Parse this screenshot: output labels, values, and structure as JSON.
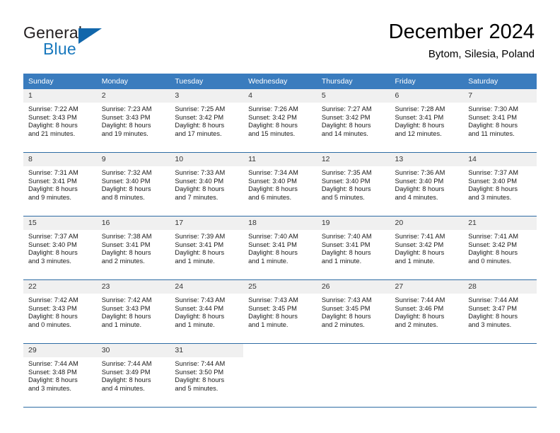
{
  "brand": {
    "name_part1": "General",
    "name_part2": "Blue"
  },
  "header": {
    "title": "December 2024",
    "location": "Bytom, Silesia, Poland"
  },
  "colors": {
    "header_row_bg": "#3a7cbe",
    "day_band_bg": "#f0f0f0",
    "row_divider": "#2e6ca4",
    "brand_blue": "#1878bd"
  },
  "weekdays": [
    "Sunday",
    "Monday",
    "Tuesday",
    "Wednesday",
    "Thursday",
    "Friday",
    "Saturday"
  ],
  "weeks": [
    [
      {
        "day": "1",
        "sunrise": "Sunrise: 7:22 AM",
        "sunset": "Sunset: 3:43 PM",
        "daylight_line1": "Daylight: 8 hours",
        "daylight_line2": "and 21 minutes."
      },
      {
        "day": "2",
        "sunrise": "Sunrise: 7:23 AM",
        "sunset": "Sunset: 3:43 PM",
        "daylight_line1": "Daylight: 8 hours",
        "daylight_line2": "and 19 minutes."
      },
      {
        "day": "3",
        "sunrise": "Sunrise: 7:25 AM",
        "sunset": "Sunset: 3:42 PM",
        "daylight_line1": "Daylight: 8 hours",
        "daylight_line2": "and 17 minutes."
      },
      {
        "day": "4",
        "sunrise": "Sunrise: 7:26 AM",
        "sunset": "Sunset: 3:42 PM",
        "daylight_line1": "Daylight: 8 hours",
        "daylight_line2": "and 15 minutes."
      },
      {
        "day": "5",
        "sunrise": "Sunrise: 7:27 AM",
        "sunset": "Sunset: 3:42 PM",
        "daylight_line1": "Daylight: 8 hours",
        "daylight_line2": "and 14 minutes."
      },
      {
        "day": "6",
        "sunrise": "Sunrise: 7:28 AM",
        "sunset": "Sunset: 3:41 PM",
        "daylight_line1": "Daylight: 8 hours",
        "daylight_line2": "and 12 minutes."
      },
      {
        "day": "7",
        "sunrise": "Sunrise: 7:30 AM",
        "sunset": "Sunset: 3:41 PM",
        "daylight_line1": "Daylight: 8 hours",
        "daylight_line2": "and 11 minutes."
      }
    ],
    [
      {
        "day": "8",
        "sunrise": "Sunrise: 7:31 AM",
        "sunset": "Sunset: 3:41 PM",
        "daylight_line1": "Daylight: 8 hours",
        "daylight_line2": "and 9 minutes."
      },
      {
        "day": "9",
        "sunrise": "Sunrise: 7:32 AM",
        "sunset": "Sunset: 3:40 PM",
        "daylight_line1": "Daylight: 8 hours",
        "daylight_line2": "and 8 minutes."
      },
      {
        "day": "10",
        "sunrise": "Sunrise: 7:33 AM",
        "sunset": "Sunset: 3:40 PM",
        "daylight_line1": "Daylight: 8 hours",
        "daylight_line2": "and 7 minutes."
      },
      {
        "day": "11",
        "sunrise": "Sunrise: 7:34 AM",
        "sunset": "Sunset: 3:40 PM",
        "daylight_line1": "Daylight: 8 hours",
        "daylight_line2": "and 6 minutes."
      },
      {
        "day": "12",
        "sunrise": "Sunrise: 7:35 AM",
        "sunset": "Sunset: 3:40 PM",
        "daylight_line1": "Daylight: 8 hours",
        "daylight_line2": "and 5 minutes."
      },
      {
        "day": "13",
        "sunrise": "Sunrise: 7:36 AM",
        "sunset": "Sunset: 3:40 PM",
        "daylight_line1": "Daylight: 8 hours",
        "daylight_line2": "and 4 minutes."
      },
      {
        "day": "14",
        "sunrise": "Sunrise: 7:37 AM",
        "sunset": "Sunset: 3:40 PM",
        "daylight_line1": "Daylight: 8 hours",
        "daylight_line2": "and 3 minutes."
      }
    ],
    [
      {
        "day": "15",
        "sunrise": "Sunrise: 7:37 AM",
        "sunset": "Sunset: 3:40 PM",
        "daylight_line1": "Daylight: 8 hours",
        "daylight_line2": "and 3 minutes."
      },
      {
        "day": "16",
        "sunrise": "Sunrise: 7:38 AM",
        "sunset": "Sunset: 3:41 PM",
        "daylight_line1": "Daylight: 8 hours",
        "daylight_line2": "and 2 minutes."
      },
      {
        "day": "17",
        "sunrise": "Sunrise: 7:39 AM",
        "sunset": "Sunset: 3:41 PM",
        "daylight_line1": "Daylight: 8 hours",
        "daylight_line2": "and 1 minute."
      },
      {
        "day": "18",
        "sunrise": "Sunrise: 7:40 AM",
        "sunset": "Sunset: 3:41 PM",
        "daylight_line1": "Daylight: 8 hours",
        "daylight_line2": "and 1 minute."
      },
      {
        "day": "19",
        "sunrise": "Sunrise: 7:40 AM",
        "sunset": "Sunset: 3:41 PM",
        "daylight_line1": "Daylight: 8 hours",
        "daylight_line2": "and 1 minute."
      },
      {
        "day": "20",
        "sunrise": "Sunrise: 7:41 AM",
        "sunset": "Sunset: 3:42 PM",
        "daylight_line1": "Daylight: 8 hours",
        "daylight_line2": "and 1 minute."
      },
      {
        "day": "21",
        "sunrise": "Sunrise: 7:41 AM",
        "sunset": "Sunset: 3:42 PM",
        "daylight_line1": "Daylight: 8 hours",
        "daylight_line2": "and 0 minutes."
      }
    ],
    [
      {
        "day": "22",
        "sunrise": "Sunrise: 7:42 AM",
        "sunset": "Sunset: 3:43 PM",
        "daylight_line1": "Daylight: 8 hours",
        "daylight_line2": "and 0 minutes."
      },
      {
        "day": "23",
        "sunrise": "Sunrise: 7:42 AM",
        "sunset": "Sunset: 3:43 PM",
        "daylight_line1": "Daylight: 8 hours",
        "daylight_line2": "and 1 minute."
      },
      {
        "day": "24",
        "sunrise": "Sunrise: 7:43 AM",
        "sunset": "Sunset: 3:44 PM",
        "daylight_line1": "Daylight: 8 hours",
        "daylight_line2": "and 1 minute."
      },
      {
        "day": "25",
        "sunrise": "Sunrise: 7:43 AM",
        "sunset": "Sunset: 3:45 PM",
        "daylight_line1": "Daylight: 8 hours",
        "daylight_line2": "and 1 minute."
      },
      {
        "day": "26",
        "sunrise": "Sunrise: 7:43 AM",
        "sunset": "Sunset: 3:45 PM",
        "daylight_line1": "Daylight: 8 hours",
        "daylight_line2": "and 2 minutes."
      },
      {
        "day": "27",
        "sunrise": "Sunrise: 7:44 AM",
        "sunset": "Sunset: 3:46 PM",
        "daylight_line1": "Daylight: 8 hours",
        "daylight_line2": "and 2 minutes."
      },
      {
        "day": "28",
        "sunrise": "Sunrise: 7:44 AM",
        "sunset": "Sunset: 3:47 PM",
        "daylight_line1": "Daylight: 8 hours",
        "daylight_line2": "and 3 minutes."
      }
    ],
    [
      {
        "day": "29",
        "sunrise": "Sunrise: 7:44 AM",
        "sunset": "Sunset: 3:48 PM",
        "daylight_line1": "Daylight: 8 hours",
        "daylight_line2": "and 3 minutes."
      },
      {
        "day": "30",
        "sunrise": "Sunrise: 7:44 AM",
        "sunset": "Sunset: 3:49 PM",
        "daylight_line1": "Daylight: 8 hours",
        "daylight_line2": "and 4 minutes."
      },
      {
        "day": "31",
        "sunrise": "Sunrise: 7:44 AM",
        "sunset": "Sunset: 3:50 PM",
        "daylight_line1": "Daylight: 8 hours",
        "daylight_line2": "and 5 minutes."
      },
      {
        "day": "",
        "sunrise": "",
        "sunset": "",
        "daylight_line1": "",
        "daylight_line2": ""
      },
      {
        "day": "",
        "sunrise": "",
        "sunset": "",
        "daylight_line1": "",
        "daylight_line2": ""
      },
      {
        "day": "",
        "sunrise": "",
        "sunset": "",
        "daylight_line1": "",
        "daylight_line2": ""
      },
      {
        "day": "",
        "sunrise": "",
        "sunset": "",
        "daylight_line1": "",
        "daylight_line2": ""
      }
    ]
  ]
}
